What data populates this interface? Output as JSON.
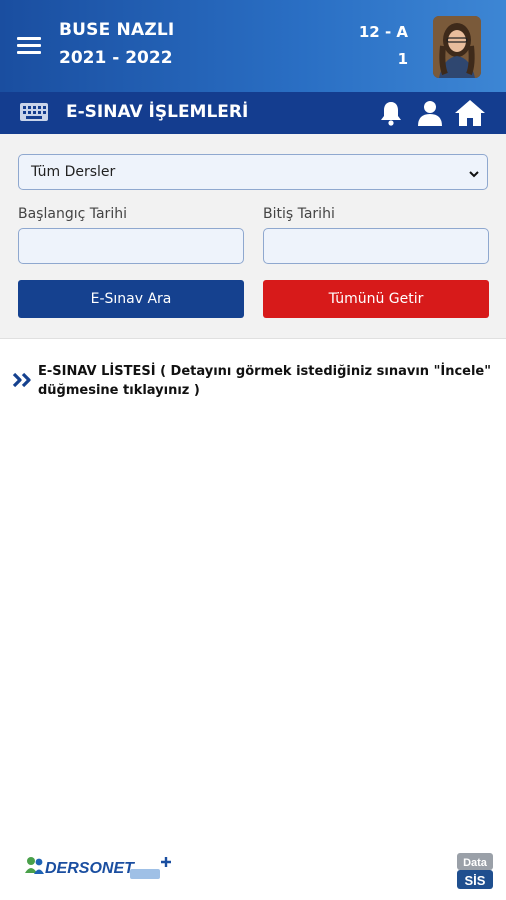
{
  "header": {
    "user_name": "BUSE NAZLI",
    "school_year": "2021 - 2022",
    "class_name": "12 - A",
    "class_number": "1"
  },
  "title_bar": {
    "title": "E-SINAV İŞLEMLERİ"
  },
  "filters": {
    "course_select_value": "Tüm Dersler",
    "start_date_label": "Başlangıç Tarihi",
    "end_date_label": "Bitiş Tarihi",
    "start_date_value": "",
    "end_date_value": "",
    "search_button_label": "E-Sınav Ara",
    "get_all_button_label": "Tümünü Getir"
  },
  "list": {
    "heading": "E-SINAV LİSTESİ",
    "instruction": " ( Detayını görmek istediğiniz sınavın \"İncele\" düğmesine tıklayınız )"
  },
  "footer": {
    "dersonet_logo": "DERSONET",
    "datasis_logo_top": "Data",
    "datasis_logo_bottom": "SİS"
  },
  "colors": {
    "header_blue": "#1a4ea0",
    "title_bar_blue": "#143d8f",
    "search_button_blue": "#15418f",
    "get_all_button_red": "#d71a1a",
    "panel_gray": "#f2f2f2"
  },
  "icons": {
    "menu": "hamburger-icon",
    "keyboard": "keyboard-icon",
    "bell": "bell-icon",
    "user": "user-icon",
    "home": "home-icon",
    "list_marker": "double-chevron-right-icon",
    "select_arrow": "chevron-down-icon"
  }
}
